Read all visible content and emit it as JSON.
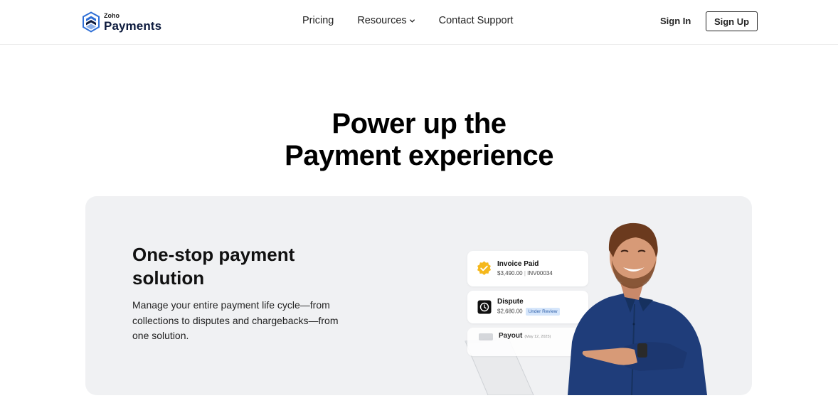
{
  "header": {
    "logo_small": "Zoho",
    "logo_big": "Payments",
    "nav": [
      {
        "label": "Pricing"
      },
      {
        "label": "Resources"
      },
      {
        "label": "Contact Support"
      }
    ],
    "sign_in": "Sign In",
    "sign_up": "Sign Up"
  },
  "hero": {
    "title_line1": "Power up the",
    "title_line2": "Payment experience"
  },
  "feature": {
    "title": "One-stop payment solution",
    "description": "Manage your entire payment life cycle—from collections to disputes and chargebacks—from one solution."
  },
  "notifications": {
    "invoice": {
      "title": "Invoice Paid",
      "amount": "$3,490.00",
      "ref": "INV00034"
    },
    "dispute": {
      "title": "Dispute",
      "amount": "$2,680.00",
      "status": "Under Review"
    },
    "payout": {
      "title": "Payout",
      "date": "(May 12, 2025)"
    }
  },
  "colors": {
    "brand_navy": "#0d1b3e",
    "card_bg": "#f0f1f3",
    "badge_yellow": "#f5b81c",
    "status_pill_bg": "#d6e6fb",
    "shirt_blue": "#1f3d7a"
  }
}
